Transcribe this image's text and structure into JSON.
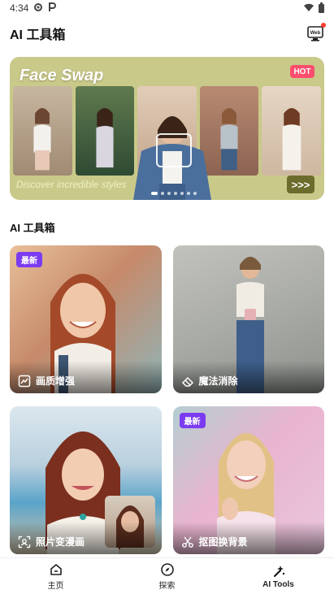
{
  "status_bar": {
    "time": "4:34",
    "left_icons": [
      "app-gear-icon",
      "p-icon"
    ],
    "right_icons": [
      "wifi-icon",
      "battery-icon"
    ]
  },
  "header": {
    "title": "AI 工具箱",
    "web_button_label": "Web"
  },
  "banner": {
    "title": "Face Swap",
    "badge": "HOT",
    "cta": "Discover incredible styles",
    "arrow_label": ">>>",
    "page_count": 7,
    "active_page": 1
  },
  "section": {
    "title": "AI 工具箱"
  },
  "tools": [
    {
      "label": "画质增强",
      "badge": "最新",
      "icon": "enhance-icon"
    },
    {
      "label": "魔法消除",
      "badge": "",
      "icon": "eraser-icon"
    },
    {
      "label": "照片变漫画",
      "badge": "",
      "icon": "portrait-scan-icon"
    },
    {
      "label": "抠图换背景",
      "badge": "最新",
      "icon": "scissors-icon"
    }
  ],
  "bottom_nav": [
    {
      "label": "主页",
      "icon": "home-icon"
    },
    {
      "label": "探索",
      "icon": "compass-icon"
    },
    {
      "label": "AI Tools",
      "icon": "sparkle-icon",
      "active": true
    }
  ],
  "colors": {
    "accent_purple": "#7b3cf1",
    "hot_red": "#ff4d6d",
    "banner_bg": "#c9c98a"
  }
}
